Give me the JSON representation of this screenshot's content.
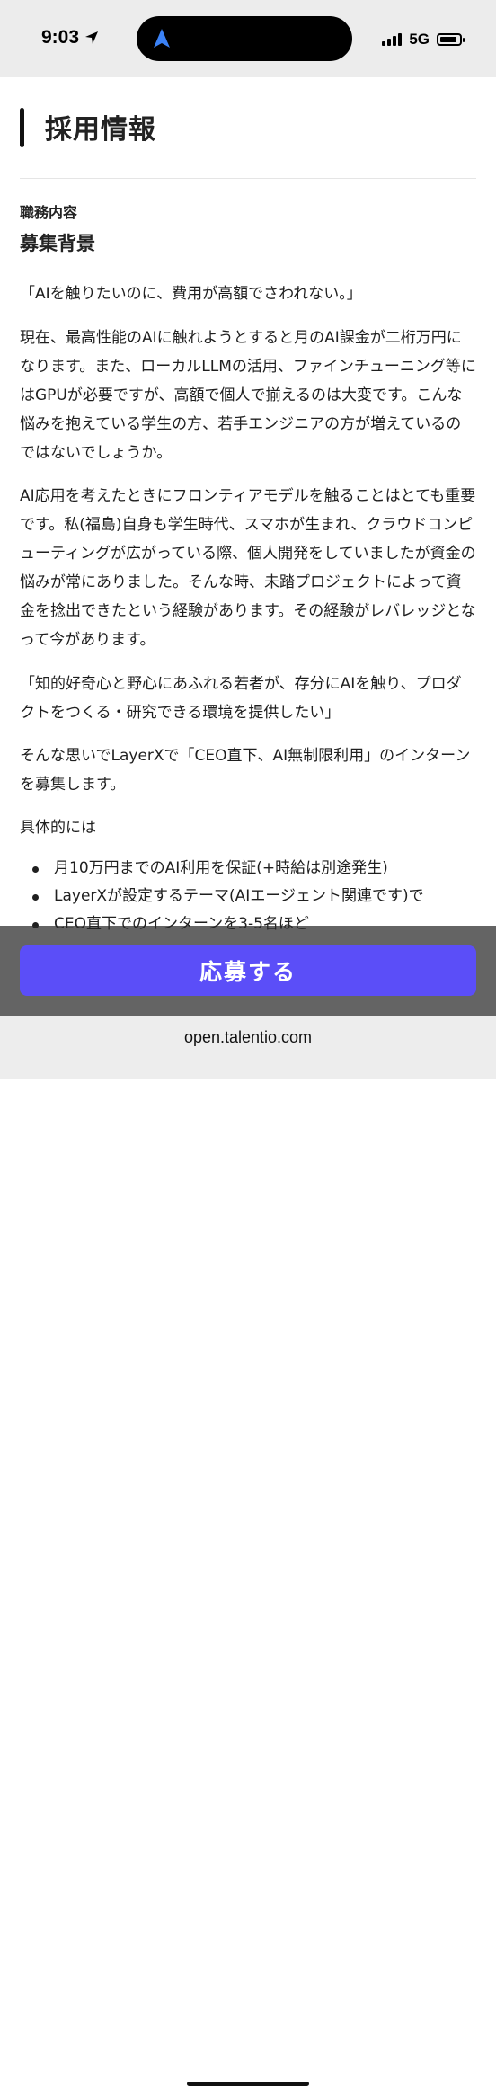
{
  "status_bar": {
    "time": "9:03",
    "network": "5G"
  },
  "section": {
    "title": "採用情報"
  },
  "job": {
    "label": "職務内容",
    "heading": "募集背景",
    "paragraphs": [
      "「AIを触りたいのに、費用が高額でさわれない。」",
      "現在、最高性能のAIに触れようとすると月のAI課金が二桁万円になります。また、ローカルLLMの活用、ファインチューニング等にはGPUが必要ですが、高額で個人で揃えるのは大変です。こんな悩みを抱えている学生の方、若手エンジニアの方が増えているのではないでしょうか。",
      "AI応用を考えたときにフロンティアモデルを触ることはとても重要です。私(福島)自身も学生時代、スマホが生まれ、クラウドコンピューティングが広がっている際、個人開発をしていましたが資金の悩みが常にありました。そんな時、未踏プロジェクトによって資金を捻出できたという経験があります。その経験がレバレッジとなって今があります。",
      "「知的好奇心と野心にあふれる若者が、存分にAIを触り、プロダクトをつくる・研究できる環境を提供したい」",
      "そんな思いでLayerXで「CEO直下、AI無制限利用」のインターンを募集します。",
      "具体的には"
    ],
    "bullets": [
      "月10万円までのAI利用を保証(+時給は別途発生)",
      "LayerXが設定するテーマ(AIエージェント関連です)で",
      "CEO直下でのインターンを3-5名ほど"
    ]
  },
  "apply_button": {
    "label": "応募する"
  },
  "browser": {
    "url": "open.talentio.com"
  },
  "colors": {
    "accent": "#5b4ef8",
    "status_bar_bg": "#ececec",
    "nav_arrow": "#3b82f6"
  }
}
